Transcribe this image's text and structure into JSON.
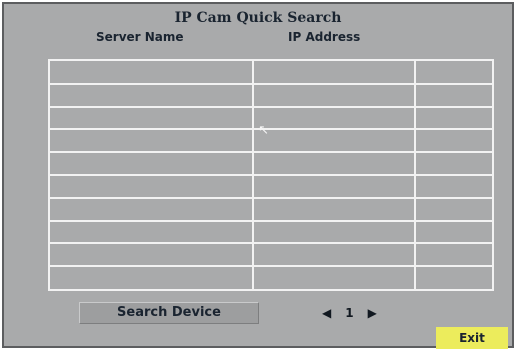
{
  "dialog": {
    "title": "IP Cam Quick Search"
  },
  "table": {
    "columns": [
      "Server Name",
      "IP Address",
      ""
    ],
    "row_count": 10,
    "rows": []
  },
  "search_button": {
    "label": "Search Device"
  },
  "pagination": {
    "prev_icon": "triangle-left-icon",
    "page": "1",
    "next_icon": "triangle-right-icon"
  },
  "exit_button": {
    "label": "Exit",
    "color": "#ecec5c"
  },
  "colors": {
    "background": "#a9aaab",
    "grid_lines": "#f2f2f2",
    "text": "#1a2430"
  }
}
